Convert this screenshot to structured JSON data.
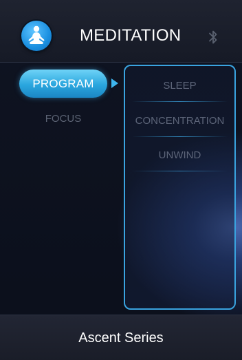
{
  "header": {
    "title": "MEDITATION",
    "logo_icon": "meditation-pose-icon",
    "status_icon": "bluetooth-icon"
  },
  "menu": {
    "items": [
      {
        "label": "PROGRAM",
        "selected": true
      },
      {
        "label": "FOCUS",
        "selected": false
      }
    ]
  },
  "submenu": {
    "items": [
      {
        "label": "SLEEP"
      },
      {
        "label": "CONCENTRATION"
      },
      {
        "label": "UNWIND"
      }
    ]
  },
  "footer": {
    "label": "Ascent Series"
  },
  "colors": {
    "accent": "#3aa4e0",
    "selected_pill": "#2aa6de",
    "inactive_text": "#5c6374",
    "background": "#0b0e18"
  }
}
